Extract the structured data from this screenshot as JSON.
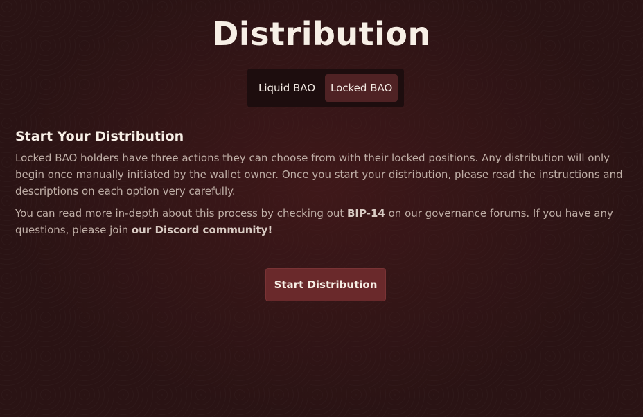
{
  "page": {
    "title": "Distribution"
  },
  "tabs": {
    "items": [
      {
        "label": "Liquid BAO",
        "active": false
      },
      {
        "label": "Locked BAO",
        "active": true
      }
    ]
  },
  "section": {
    "title": "Start Your Distribution",
    "paragraph1": "Locked BAO holders have three actions they can choose from with their locked positions. Any distribution will only begin once manually initiated by the wallet owner. Once you start your distribution, please read the instructions and descriptions on each option very carefully.",
    "paragraph2": {
      "before_link1": "You can read more in-depth about this process by checking out ",
      "link1": "BIP-14",
      "between": " on our governance forums. If you have any questions, please join ",
      "link2": "our Discord community!"
    }
  },
  "actions": {
    "start_label": "Start Distribution"
  },
  "colors": {
    "background": "#2a1314",
    "accent": "#6a292b",
    "active_tab": "#4f2224"
  }
}
